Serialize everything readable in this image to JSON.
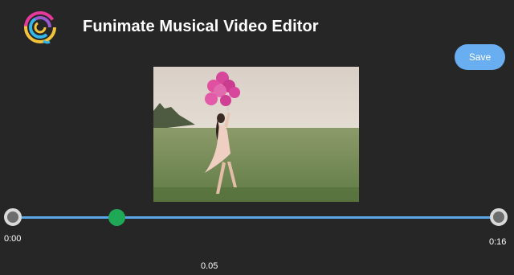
{
  "app": {
    "title": "Funimate Musical Video Editor",
    "logo_icon": "funimate-swirl-logo"
  },
  "toolbar": {
    "save_label": "Save"
  },
  "timeline": {
    "start_time": "0:00",
    "end_time": "0:16",
    "current_time": "0.05",
    "track_color": "#59a7e6",
    "playhead_color": "#1fa855"
  },
  "colors": {
    "background": "#262626",
    "accent": "#6aaef2"
  }
}
